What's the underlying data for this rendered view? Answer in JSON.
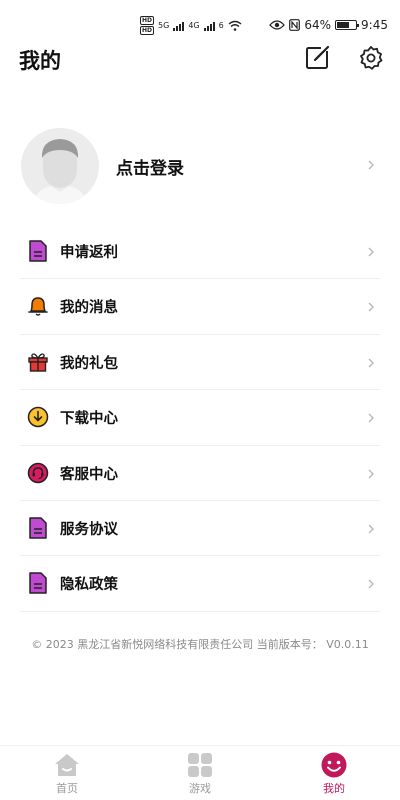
{
  "status_bar": {
    "hd1": "HD",
    "hd2": "HD",
    "net1": "5G",
    "net2": "4G",
    "wifi": "6",
    "battery_percent": "64%",
    "time": "9:45",
    "icons": [
      "eye-icon",
      "nfc-icon",
      "battery-icon",
      "wifi-icon",
      "signal-icon"
    ]
  },
  "header": {
    "title": "我的",
    "edit_icon": "edit-icon",
    "settings_icon": "gear-icon"
  },
  "profile": {
    "login_label": "点击登录",
    "avatar_icon": "default-avatar"
  },
  "menu": [
    {
      "label": "申请返利",
      "icon": "document-icon",
      "color": "#9c27b0"
    },
    {
      "label": "我的消息",
      "icon": "bell-icon",
      "color": "#ef6c00"
    },
    {
      "label": "我的礼包",
      "icon": "gift-icon",
      "color": "#c62828"
    },
    {
      "label": "下载中心",
      "icon": "download-icon",
      "color": "#f9a825"
    },
    {
      "label": "客服中心",
      "icon": "headset-icon",
      "color": "#c2185b"
    },
    {
      "label": "服务协议",
      "icon": "document-icon",
      "color": "#9c27b0"
    },
    {
      "label": "隐私政策",
      "icon": "document-icon",
      "color": "#9c27b0"
    }
  ],
  "footer": {
    "copyright": "© 2023 黑龙江省新悦网络科技有限责任公司 当前版本号： V0.0.11"
  },
  "bottom_nav": [
    {
      "label": "首页",
      "icon": "home-icon",
      "active": false
    },
    {
      "label": "游戏",
      "icon": "grid-icon",
      "active": false
    },
    {
      "label": "我的",
      "icon": "smile-icon",
      "active": true
    }
  ],
  "colors": {
    "accent": "#c2185b",
    "inactive": "#9a9a9a",
    "divider": "#eeeeee"
  }
}
